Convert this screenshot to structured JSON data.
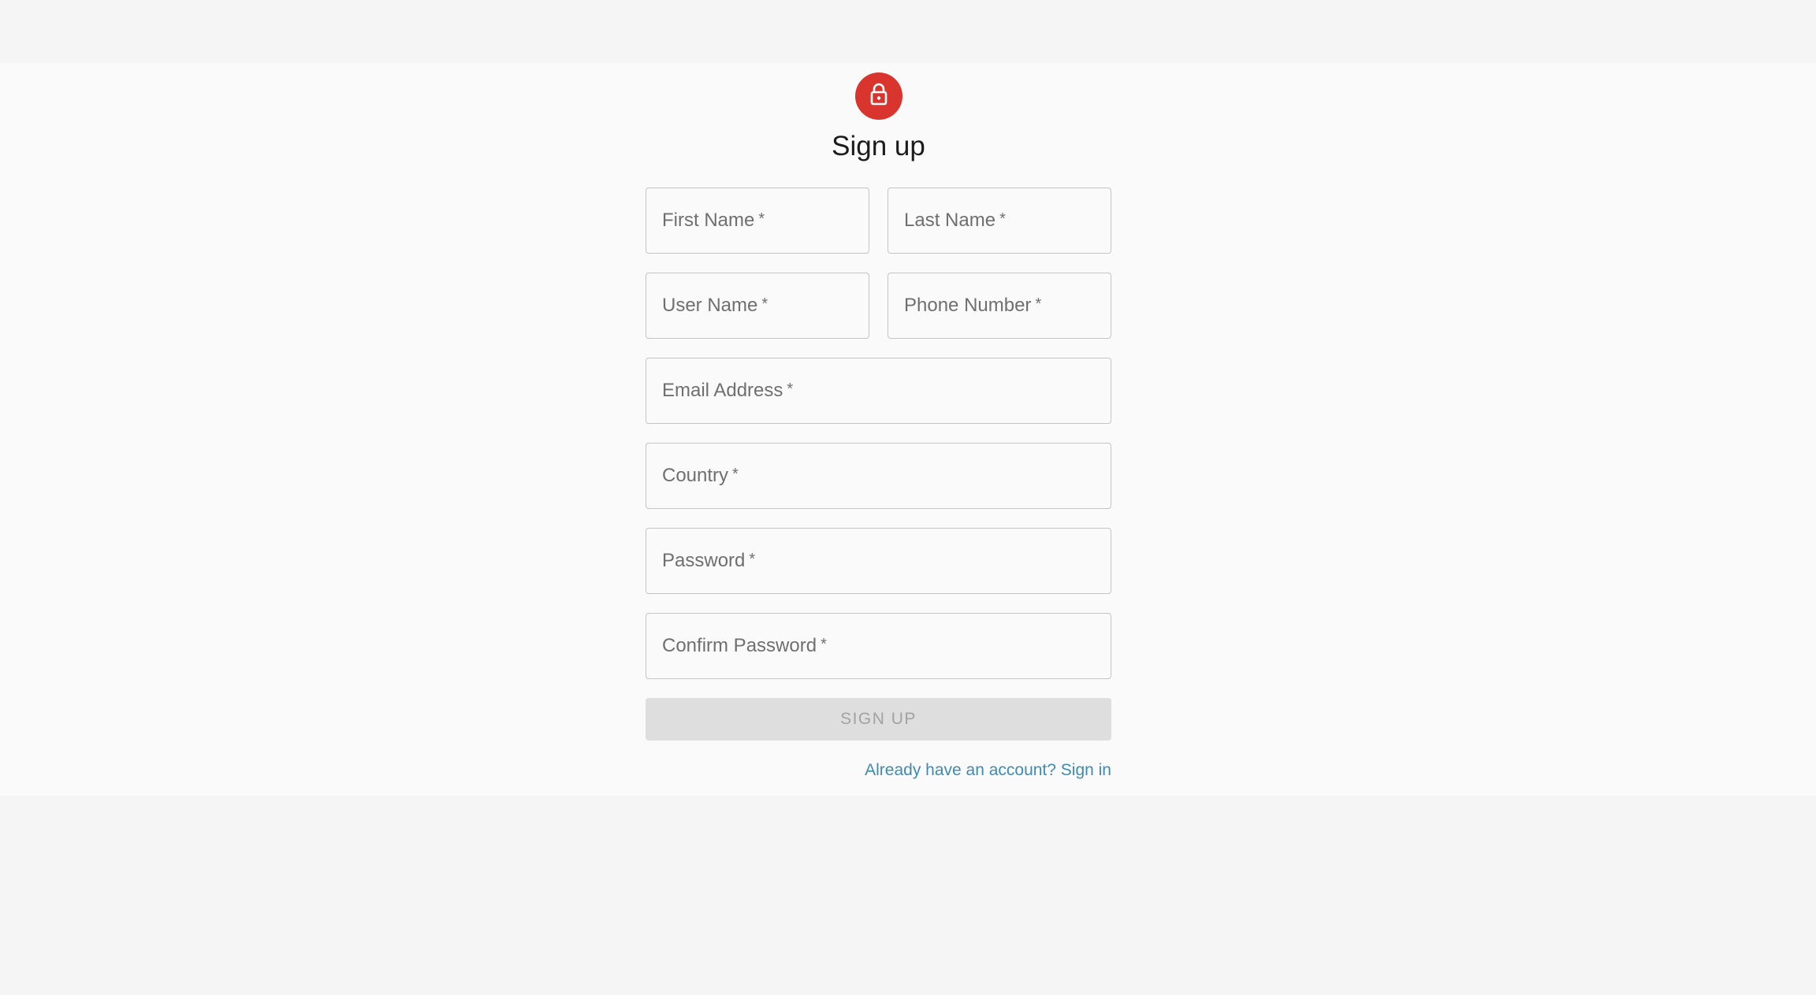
{
  "header": {
    "icon": "lock-icon",
    "title": "Sign up",
    "accent_color": "#d9352e"
  },
  "form": {
    "fields": {
      "first_name": {
        "label": "First Name",
        "required": "*"
      },
      "last_name": {
        "label": "Last Name",
        "required": "*"
      },
      "user_name": {
        "label": "User Name",
        "required": "*"
      },
      "phone_number": {
        "label": "Phone Number",
        "required": "*"
      },
      "email": {
        "label": "Email Address",
        "required": "*"
      },
      "country": {
        "label": "Country",
        "required": "*"
      },
      "password": {
        "label": "Password",
        "required": "*"
      },
      "confirm_password": {
        "label": "Confirm Password",
        "required": "*"
      }
    },
    "submit_label": "SIGN UP",
    "signin_link": "Already have an account? Sign in",
    "link_color": "#3e8cb3"
  }
}
